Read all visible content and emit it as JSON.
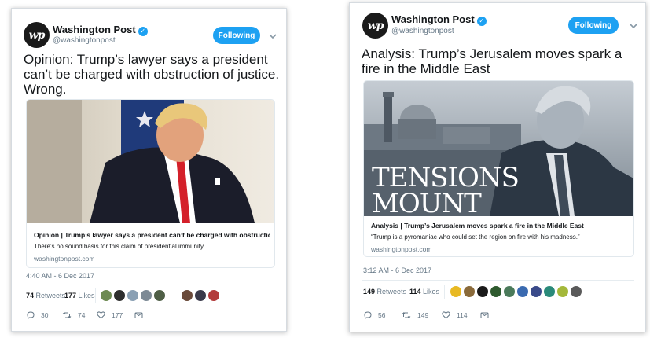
{
  "left_tweet": {
    "account": {
      "avatar_text": "wp",
      "name": "Washington Post",
      "handle": "@washingtonpost",
      "follow_label": "Following"
    },
    "text": "Opinion: Trump’s lawyer says a president can’t be charged with obstruction of justice. Wrong.",
    "card": {
      "title": "Opinion | Trump’s lawyer says a president can’t be charged with obstruction ...",
      "description": "There’s no sound basis for this claim of presidential immunity.",
      "domain": "washingtonpost.com"
    },
    "timestamp": "4:40 AM - 6 Dec 2017",
    "stats": {
      "retweets_count": "74",
      "retweets_label": "Retweets",
      "likes_count": "177",
      "likes_label": "Likes"
    },
    "actions": {
      "replies": "30",
      "retweets": "74",
      "likes": "177"
    },
    "liker_colors": [
      "#6d8a52",
      "#2f2f2f",
      "#8aa0b4",
      "#7d8a95",
      "#4f5f46",
      "#6a4a3a",
      "#3a3a4a",
      "#b23a3a",
      "#d06060"
    ]
  },
  "right_tweet": {
    "account": {
      "avatar_text": "wp",
      "name": "Washington Post",
      "handle": "@washingtonpost",
      "follow_label": "Following"
    },
    "text": "Analysis: Trump’s Jerusalem moves spark a fire in the Middle East",
    "card": {
      "image_headline_1": "TENSIONS",
      "image_headline_2": "MOUNT",
      "title": "Analysis | Trump’s Jerusalem moves spark a fire in the Middle East",
      "description": "“Trump is a pyromaniac who could set the region on fire with his madness.”",
      "domain": "washingtonpost.com"
    },
    "timestamp": "3:12 AM - 6 Dec 2017",
    "stats": {
      "retweets_count": "149",
      "retweets_label": "Retweets",
      "likes_count": "114",
      "likes_label": "Likes"
    },
    "actions": {
      "replies": "56",
      "retweets": "149",
      "likes": "114"
    },
    "liker_colors": [
      "#e8b923",
      "#8a6a3a",
      "#1a1a1a",
      "#2e5a2e",
      "#4a7a5a",
      "#3a6ab0",
      "#3a4a8a",
      "#2a8a7a",
      "#a4b83a",
      "#5a5a5a",
      "#a05070"
    ]
  },
  "colors": {
    "brand_blue": "#1da1f2",
    "text_primary": "#14171a",
    "text_secondary": "#657786"
  },
  "icons": [
    "wp-logo-icon",
    "verified-badge-icon",
    "chevron-down-icon",
    "reply-icon",
    "retweet-icon",
    "like-icon",
    "message-icon"
  ]
}
